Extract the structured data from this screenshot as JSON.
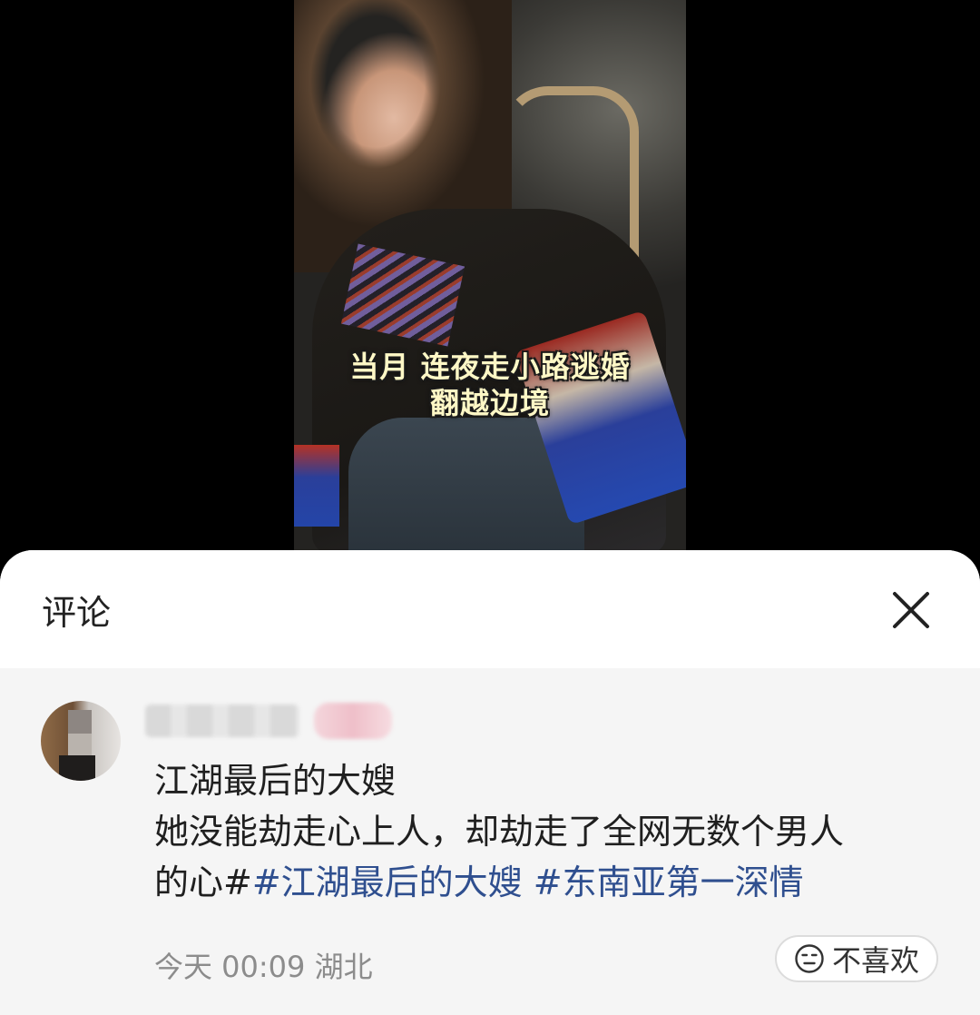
{
  "video": {
    "subtitle_line1": "当月 连夜走小路逃婚",
    "subtitle_line2": "翻越边境"
  },
  "comments_panel": {
    "title": "评论",
    "close_icon": "close-icon"
  },
  "comment": {
    "username": "",
    "text_line1": "江湖最后的大嫂",
    "text_line2": "她没能劫走心上人，却劫走了全网无数个男人",
    "text_line3_prefix": "的心#",
    "hashtag1": "#江湖最后的大嫂",
    "hashtag2": "#东南亚第一深情",
    "time": "今天 00:09",
    "location": "湖北",
    "dislike_label": "不喜欢",
    "dislike_icon": "neutral-face-icon"
  },
  "colors": {
    "hashtag": "#2f4f8f",
    "sheet_bg": "#ffffff",
    "comment_bg": "#f5f5f5",
    "meta_text": "#8c8c8c"
  }
}
